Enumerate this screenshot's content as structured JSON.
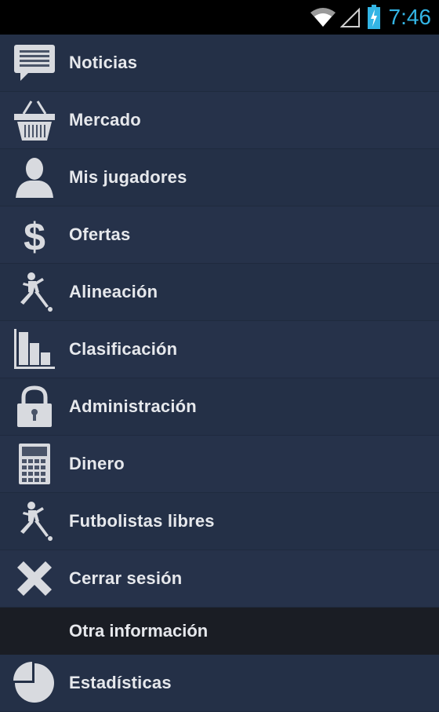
{
  "status": {
    "time": "7:46",
    "time_color": "#33b5e5",
    "icons": [
      "wifi-icon",
      "signal-icon",
      "battery-charging-icon"
    ]
  },
  "menu": {
    "items": [
      {
        "label": "Noticias",
        "icon": "news-icon"
      },
      {
        "label": "Mercado",
        "icon": "basket-icon"
      },
      {
        "label": "Mis jugadores",
        "icon": "person-icon"
      },
      {
        "label": "Ofertas",
        "icon": "dollar-icon"
      },
      {
        "label": "Alineación",
        "icon": "footballer-icon"
      },
      {
        "label": "Clasificación",
        "icon": "bar-chart-icon"
      },
      {
        "label": "Administración",
        "icon": "lock-icon"
      },
      {
        "label": "Dinero",
        "icon": "calculator-icon"
      },
      {
        "label": "Futbolistas libres",
        "icon": "footballer-icon"
      },
      {
        "label": "Cerrar sesión",
        "icon": "close-icon"
      }
    ],
    "section_header": "Otra información",
    "extra_items": [
      {
        "label": "Estadísticas",
        "icon": "pie-chart-icon"
      }
    ]
  },
  "colors": {
    "background": "#243047",
    "section_background": "#1a1d24",
    "text": "#e6e8ec",
    "icon": "#d8dadf"
  }
}
